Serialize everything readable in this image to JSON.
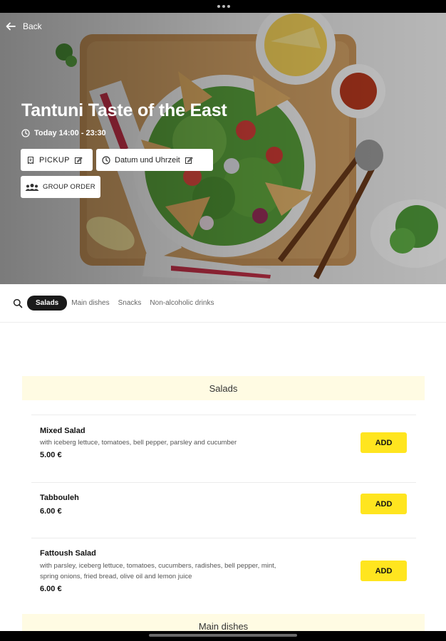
{
  "header": {
    "back_label": "Back"
  },
  "restaurant": {
    "name": "Tantuni Taste of the East",
    "hours": "Today 14:00 - 23:30"
  },
  "order_options": {
    "pickup_label": "PICKUP",
    "datetime_label": "Datum und Uhrzeit",
    "group_order_label": "GROUP ORDER"
  },
  "categories": [
    {
      "label": "Salads",
      "active": true
    },
    {
      "label": "Main dishes",
      "active": false
    },
    {
      "label": "Snacks",
      "active": false
    },
    {
      "label": "Non-alcoholic drinks",
      "active": false
    }
  ],
  "sections": [
    {
      "title": "Salads",
      "items": [
        {
          "name": "Mixed Salad",
          "description": "with iceberg lettuce, tomatoes, bell pepper, parsley and cucumber",
          "price": "5.00 €",
          "add_label": "ADD"
        },
        {
          "name": "Tabbouleh",
          "description": "",
          "price": "6.00 €",
          "add_label": "ADD"
        },
        {
          "name": "Fattoush Salad",
          "description": "with parsley, iceberg lettuce, tomatoes, cucumbers, radishes, bell pepper, mint, spring onions, fried bread, olive oil and lemon juice",
          "price": "6.00 €",
          "add_label": "ADD"
        }
      ]
    },
    {
      "title": "Main dishes",
      "items": []
    }
  ],
  "colors": {
    "accent_yellow": "#ffe51f",
    "section_bg": "#fffbe3",
    "active_tab": "#1a1a1a"
  },
  "icons": [
    "arrow-left-icon",
    "clock-icon",
    "receipt-icon",
    "edit-icon",
    "users-icon",
    "search-icon"
  ]
}
